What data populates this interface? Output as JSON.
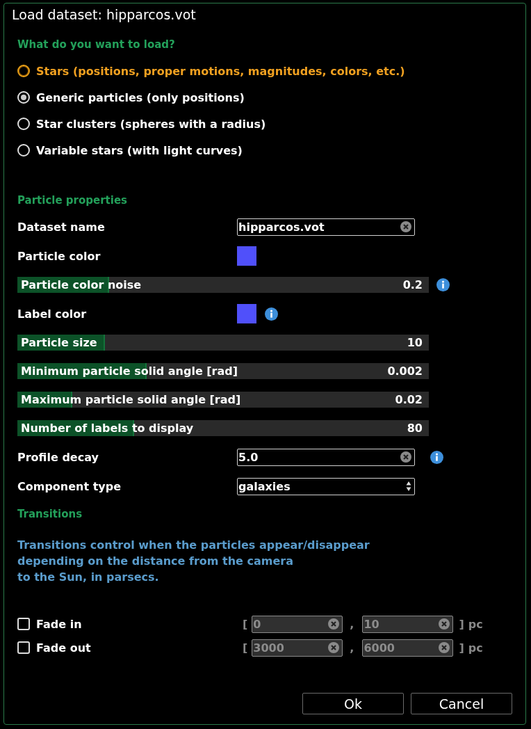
{
  "window": {
    "title": "Load dataset: hipparcos.vot"
  },
  "load_section": {
    "heading": "What do you want to load?",
    "options": [
      {
        "label": "Stars (positions, proper motions, magnitudes, colors, etc.)",
        "selected": false,
        "hovered": true
      },
      {
        "label": "Generic particles (only positions)",
        "selected": true,
        "hovered": false
      },
      {
        "label": "Star clusters (spheres with a radius)",
        "selected": false,
        "hovered": false
      },
      {
        "label": "Variable stars (with light curves)",
        "selected": false,
        "hovered": false
      }
    ]
  },
  "properties": {
    "heading": "Particle properties",
    "rows": [
      {
        "kind": "text",
        "label": "Dataset name",
        "value": "hipparcos.vot",
        "info": false
      },
      {
        "kind": "color",
        "label": "Particle color",
        "color": "#5050fa",
        "info": false
      },
      {
        "kind": "slider",
        "label": "Particle color noise",
        "reading": "0.2",
        "level": 0.22,
        "info": true
      },
      {
        "kind": "color",
        "label": "Label color",
        "color": "#5050fa",
        "info": true
      },
      {
        "kind": "slider",
        "label": "Particle size",
        "reading": "10",
        "level": 0.21,
        "info": false
      },
      {
        "kind": "slider",
        "label": "Minimum particle solid angle [rad]",
        "reading": "0.002",
        "level": 0.31,
        "info": false
      },
      {
        "kind": "slider",
        "label": "Maximum particle solid angle [rad]",
        "reading": "0.02",
        "level": 0.13,
        "info": false
      },
      {
        "kind": "slider",
        "label": "Number of labels to display",
        "reading": "80",
        "level": 0.28,
        "info": false
      },
      {
        "kind": "text",
        "label": "Profile decay",
        "value": "5.0",
        "info": true
      },
      {
        "kind": "select",
        "label": "Component type",
        "value": "galaxies",
        "info": false
      }
    ]
  },
  "transitions": {
    "heading": "Transitions",
    "description": "Transitions control when the particles appear/disappear\ndepending on the distance from the camera\nto the Sun, in parsecs.",
    "rows": [
      {
        "label": "Fade in",
        "checked": false,
        "open": "[",
        "from": "0",
        "separator": ",",
        "to": "10",
        "close": "]",
        "unit": "pc",
        "disabled": true
      },
      {
        "label": "Fade out",
        "checked": false,
        "open": "[",
        "from": "3000",
        "separator": ",",
        "to": "6000",
        "close": "]",
        "unit": "pc",
        "disabled": true
      }
    ]
  },
  "buttons": [
    {
      "label": "Ok"
    },
    {
      "label": "Cancel"
    }
  ]
}
